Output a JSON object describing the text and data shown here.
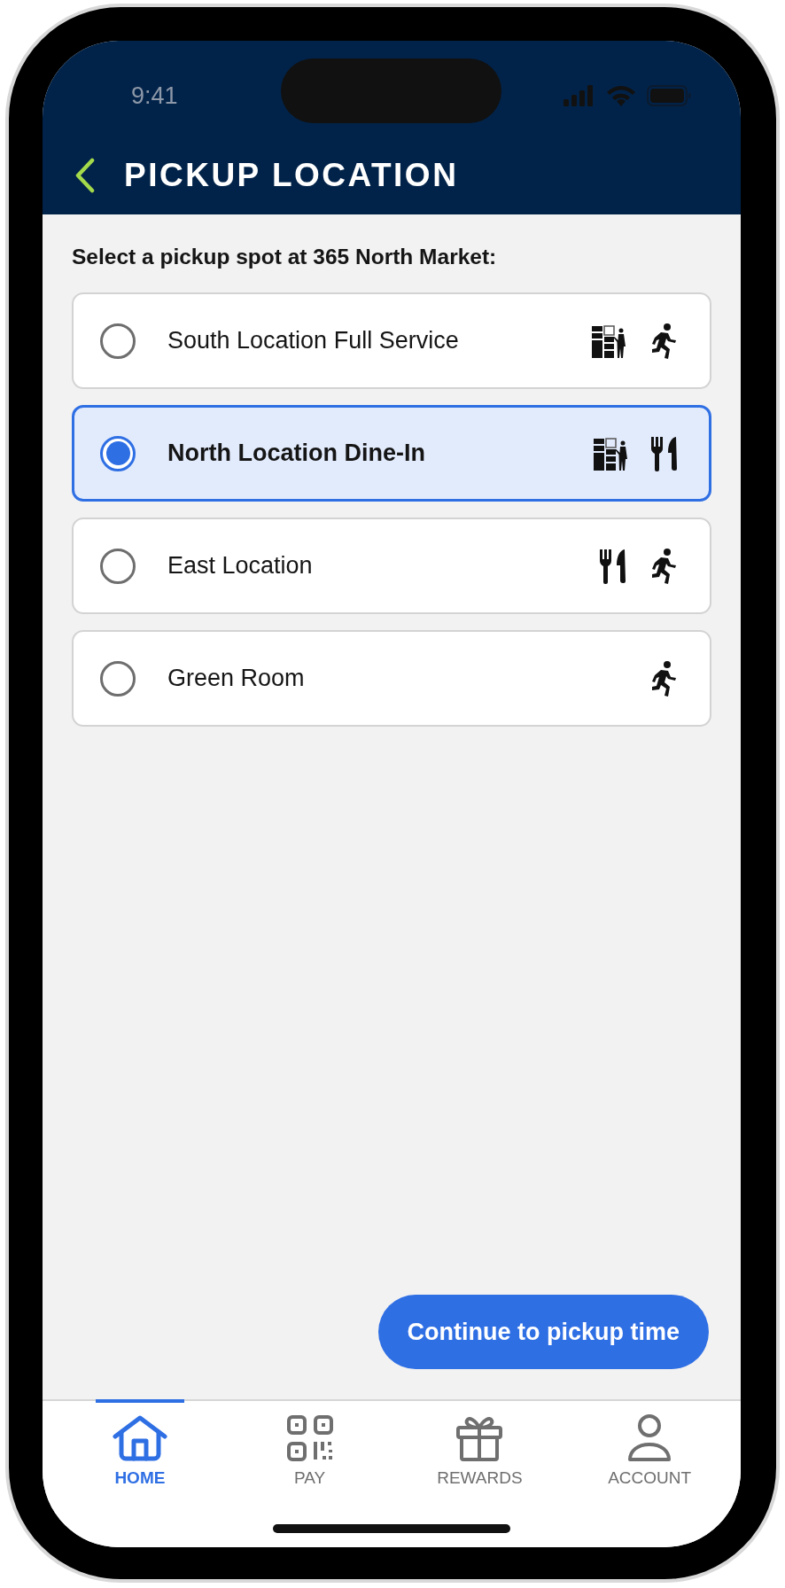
{
  "status_bar": {
    "time": "9:41"
  },
  "header": {
    "title": "PICKUP LOCATION"
  },
  "prompt": "Select a pickup spot at 365 North Market:",
  "locations": [
    {
      "name": "South Location Full Service",
      "selected": false,
      "features": [
        {
          "kind": "locker"
        },
        {
          "kind": "walk"
        }
      ]
    },
    {
      "name": "North Location Dine-In",
      "selected": true,
      "features": [
        {
          "kind": "locker"
        },
        {
          "kind": "dine"
        }
      ]
    },
    {
      "name": "East Location",
      "selected": false,
      "features": [
        {
          "kind": "dine"
        },
        {
          "kind": "walk"
        }
      ]
    },
    {
      "name": "Green Room",
      "selected": false,
      "features": [
        {
          "kind": "walk"
        }
      ]
    }
  ],
  "continue_button": "Continue to pickup time",
  "tabs": [
    {
      "label": "HOME",
      "kind": "home",
      "selected": true
    },
    {
      "label": "PAY",
      "kind": "pay",
      "selected": false
    },
    {
      "label": "REWARDS",
      "kind": "rewards",
      "selected": false
    },
    {
      "label": "ACCOUNT",
      "kind": "account",
      "selected": false
    }
  ]
}
